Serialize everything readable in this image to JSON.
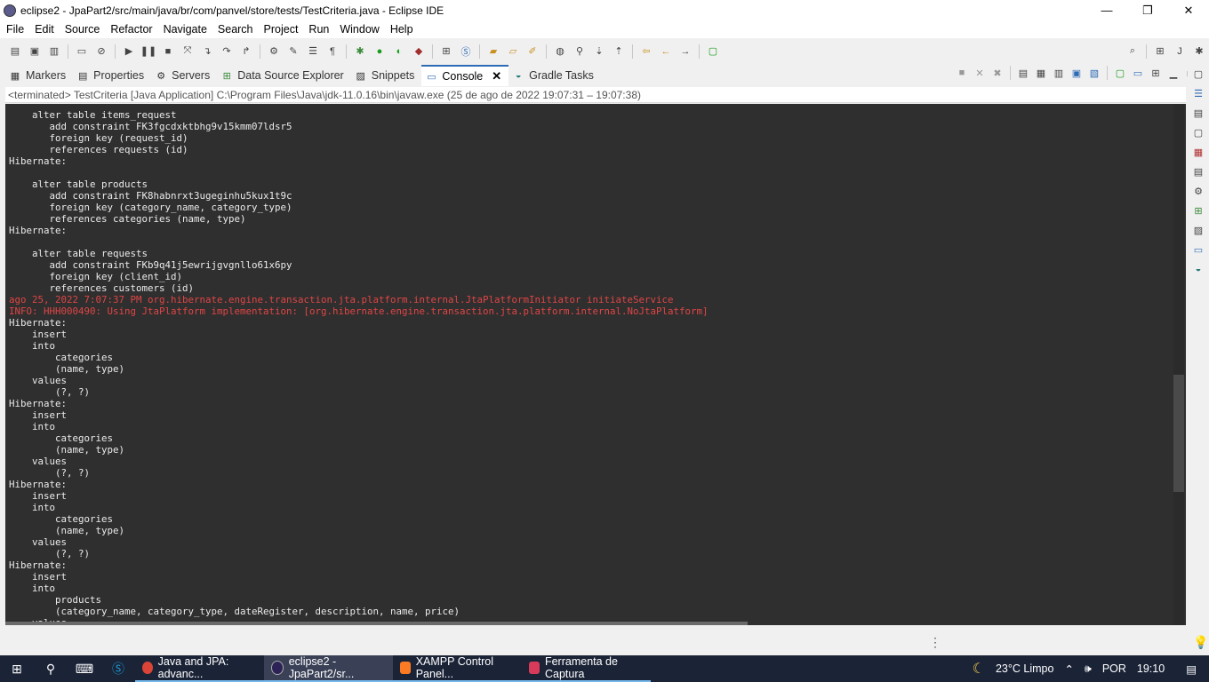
{
  "window": {
    "title": "eclipse2 - JpaPart2/src/main/java/br/com/panvel/store/tests/TestCriteria.java - Eclipse IDE",
    "minimize": "—",
    "restore": "❐",
    "close": "✕"
  },
  "menu": [
    "File",
    "Edit",
    "Source",
    "Refactor",
    "Navigate",
    "Search",
    "Project",
    "Run",
    "Window",
    "Help"
  ],
  "tabs": [
    {
      "label": "Markers",
      "icon": "markers-icon"
    },
    {
      "label": "Properties",
      "icon": "properties-icon"
    },
    {
      "label": "Servers",
      "icon": "servers-icon"
    },
    {
      "label": "Data Source Explorer",
      "icon": "data-source-icon"
    },
    {
      "label": "Snippets",
      "icon": "snippets-icon"
    },
    {
      "label": "Console",
      "icon": "console-icon",
      "active": true
    },
    {
      "label": "Gradle Tasks",
      "icon": "gradle-icon"
    }
  ],
  "console": {
    "status": "<terminated> TestCriteria [Java Application] C:\\Program Files\\Java\\jdk-11.0.16\\bin\\javaw.exe  (25 de ago de 2022 19:07:31 – 19:07:38)",
    "lines": [
      {
        "t": "    alter table items_request"
      },
      {
        "t": "       add constraint FK3fgcdxktbhg9v15kmm07ldsr5"
      },
      {
        "t": "       foreign key (request_id)"
      },
      {
        "t": "       references requests (id)"
      },
      {
        "t": "Hibernate: "
      },
      {
        "t": ""
      },
      {
        "t": "    alter table products"
      },
      {
        "t": "       add constraint FK8habnrxt3ugeginhu5kux1t9c"
      },
      {
        "t": "       foreign key (category_name, category_type)"
      },
      {
        "t": "       references categories (name, type)"
      },
      {
        "t": "Hibernate: "
      },
      {
        "t": ""
      },
      {
        "t": "    alter table requests"
      },
      {
        "t": "       add constraint FKb9q41j5ewrijgvgnllo61x6py"
      },
      {
        "t": "       foreign key (client_id)"
      },
      {
        "t": "       references customers (id)"
      },
      {
        "t": "ago 25, 2022 7:07:37 PM org.hibernate.engine.transaction.jta.platform.internal.JtaPlatformInitiator initiateService",
        "err": true
      },
      {
        "t": "INFO: HHH000490: Using JtaPlatform implementation: [org.hibernate.engine.transaction.jta.platform.internal.NoJtaPlatform]",
        "err": true
      },
      {
        "t": "Hibernate: "
      },
      {
        "t": "    insert "
      },
      {
        "t": "    into"
      },
      {
        "t": "        categories"
      },
      {
        "t": "        (name, type) "
      },
      {
        "t": "    values"
      },
      {
        "t": "        (?, ?)"
      },
      {
        "t": "Hibernate: "
      },
      {
        "t": "    insert "
      },
      {
        "t": "    into"
      },
      {
        "t": "        categories"
      },
      {
        "t": "        (name, type) "
      },
      {
        "t": "    values"
      },
      {
        "t": "        (?, ?)"
      },
      {
        "t": "Hibernate: "
      },
      {
        "t": "    insert "
      },
      {
        "t": "    into"
      },
      {
        "t": "        categories"
      },
      {
        "t": "        (name, type) "
      },
      {
        "t": "    values"
      },
      {
        "t": "        (?, ?)"
      },
      {
        "t": "Hibernate: "
      },
      {
        "t": "    insert "
      },
      {
        "t": "    into"
      },
      {
        "t": "        products"
      },
      {
        "t": "        (category_name, category_type, dateRegister, description, name, price) "
      },
      {
        "t": "    values"
      }
    ]
  },
  "taskbar": {
    "apps": [
      {
        "label": "Java and JPA: advanc...",
        "icon": "chrome-icon",
        "color": "#db4437"
      },
      {
        "label": "eclipse2 - JpaPart2/sr...",
        "icon": "eclipse-icon",
        "color": "#2c2255",
        "active": true
      },
      {
        "label": "XAMPP Control Panel...",
        "icon": "xampp-icon",
        "color": "#fb7a24"
      },
      {
        "label": "Ferramenta de Captura",
        "icon": "snipping-tool-icon",
        "color": "#d83b5a"
      }
    ],
    "weather": "23°C  Limpo",
    "lang": "POR",
    "time": "19:10"
  },
  "colors": {
    "accent": "#2e6bb5",
    "console_bg": "#2f2f2f",
    "error_text": "#e04545"
  }
}
